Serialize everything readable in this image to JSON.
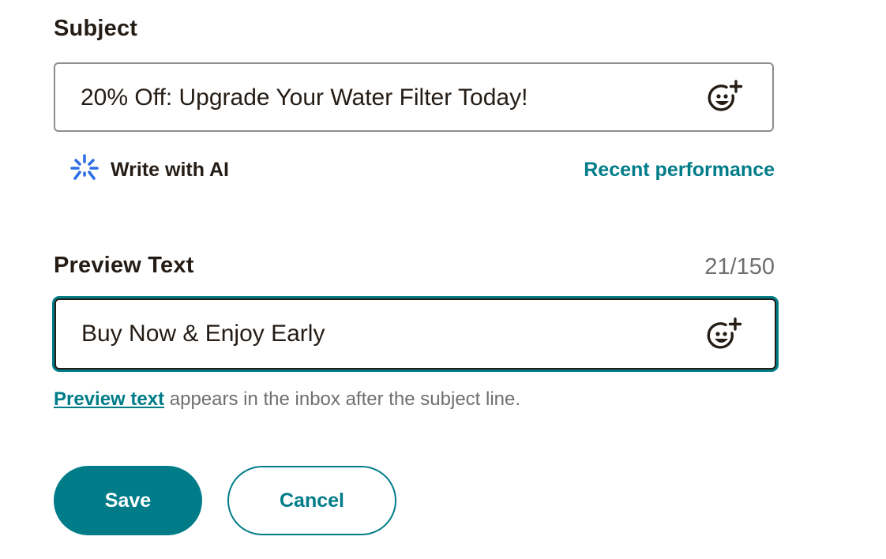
{
  "subject": {
    "label": "Subject",
    "value": "20% Off: Upgrade Your Water Filter Today!",
    "emoji_icon": "emoji-add-icon"
  },
  "ai": {
    "label": "Write with AI",
    "icon": "sparkle-icon",
    "icon_color": "#2f6fe4"
  },
  "recent_performance": {
    "label": "Recent performance"
  },
  "preview": {
    "label": "Preview Text",
    "counter": "21/150",
    "value": "Buy Now & Enjoy Early",
    "emoji_icon": "emoji-add-icon",
    "helper_link": "Preview text",
    "helper_rest": " appears in the inbox after the subject line."
  },
  "actions": {
    "save_label": "Save",
    "cancel_label": "Cancel"
  },
  "colors": {
    "accent": "#007c89",
    "text": "#241c15",
    "muted": "#6f6f6f"
  }
}
